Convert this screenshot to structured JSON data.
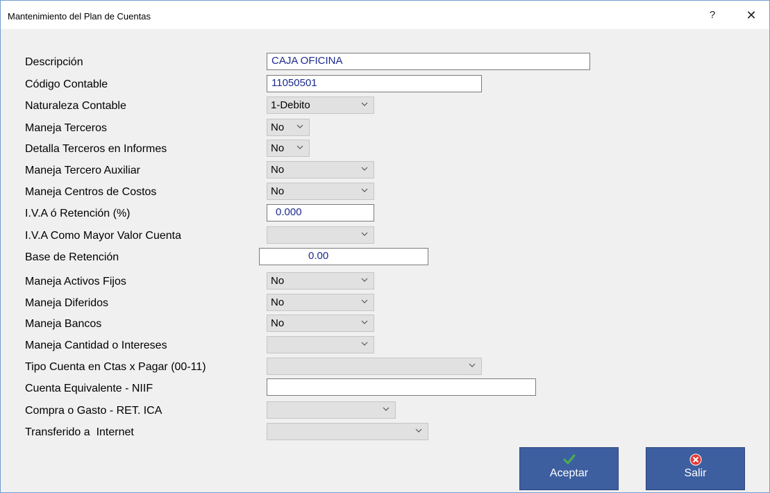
{
  "window": {
    "title": "Mantenimiento del Plan de Cuentas",
    "help_label": "?",
    "close_label": "✕"
  },
  "form": {
    "descripcion": {
      "label": "Descripción",
      "value": "CAJA OFICINA"
    },
    "codigo_contable": {
      "label": "Código Contable",
      "value": "11050501"
    },
    "naturaleza_contable": {
      "label": "Naturaleza Contable",
      "value": "1-Debito"
    },
    "maneja_terceros": {
      "label": "Maneja Terceros",
      "value": "No"
    },
    "detalla_terceros": {
      "label": "Detalla Terceros en Informes",
      "value": "No"
    },
    "maneja_tercero_auxiliar": {
      "label": "Maneja Tercero Auxiliar",
      "value": "No"
    },
    "maneja_centros_costos": {
      "label": "Maneja Centros de Costos",
      "value": "No"
    },
    "iva_retencion": {
      "label": "I.V.A ó Retención (%)",
      "value": "0.000"
    },
    "iva_mayor_valor": {
      "label": "I.V.A Como Mayor Valor Cuenta",
      "value": ""
    },
    "base_retencion": {
      "label": "Base de Retención",
      "value": "0.00"
    },
    "maneja_activos_fijos": {
      "label": "Maneja Activos Fijos",
      "value": "No"
    },
    "maneja_diferidos": {
      "label": "Maneja Diferidos",
      "value": "No"
    },
    "maneja_bancos": {
      "label": "Maneja Bancos",
      "value": "No"
    },
    "maneja_cantidad_intereses": {
      "label": "Maneja Cantidad o Intereses",
      "value": ""
    },
    "tipo_cuenta_ctas_pagar": {
      "label": "Tipo Cuenta en Ctas x Pagar (00-11)",
      "value": ""
    },
    "cuenta_equivalente_niif": {
      "label": "Cuenta Equivalente - NIIF",
      "value": ""
    },
    "compra_gasto_ret_ica": {
      "label": "Compra o Gasto - RET. ICA",
      "value": ""
    },
    "transferido_internet": {
      "label": "Transferido a  Internet",
      "value": ""
    }
  },
  "buttons": {
    "aceptar": {
      "label": "Aceptar",
      "icon": "check-icon",
      "icon_color": "#4caf50"
    },
    "salir": {
      "label": "Salir",
      "icon": "cancel-icon",
      "icon_color": "#e53935"
    }
  }
}
